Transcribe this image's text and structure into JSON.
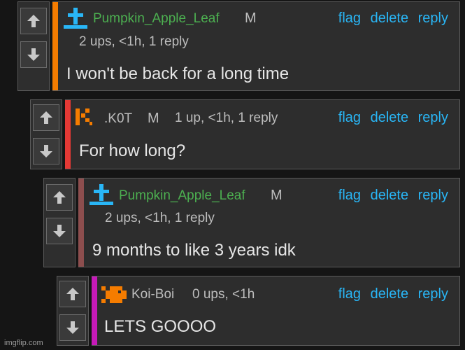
{
  "actions": {
    "flag": "flag",
    "delete": "delete",
    "reply": "reply"
  },
  "comments": [
    {
      "username": "Pumpkin_Apple_Leaf",
      "mod": "M",
      "meta": "2 ups, <1h, 1 reply",
      "text": "I won't be back for a long time",
      "bar_color": "#f57c00",
      "avatar": "cross-avatar-icon"
    },
    {
      "username": ".K0T",
      "mod": "M",
      "meta": "1 up, <1h, 1 reply",
      "text": "For how long?",
      "bar_color": "#e53935",
      "avatar": "k-avatar-icon"
    },
    {
      "username": "Pumpkin_Apple_Leaf",
      "mod": "M",
      "meta": "2 ups, <1h, 1 reply",
      "text": "9 months to like 3 years idk",
      "bar_color": "#8d4e4e",
      "avatar": "cross-avatar-icon"
    },
    {
      "username": "Koi-Boi",
      "mod": "",
      "meta": "0 ups, <1h",
      "text": "LETS GOOOO",
      "bar_color": "#c61ab8",
      "avatar": "fish-avatar-icon"
    }
  ],
  "watermark": "imgflip.com"
}
